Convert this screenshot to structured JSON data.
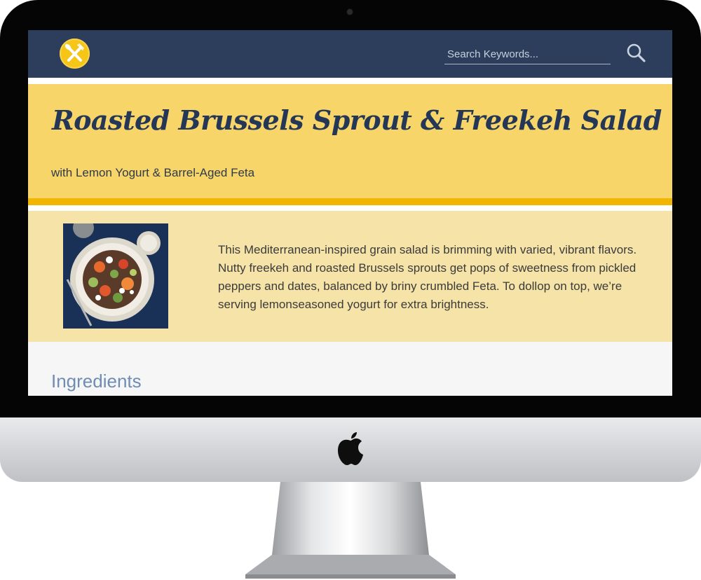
{
  "header": {
    "search": {
      "placeholder": "Search Keywords..."
    },
    "icons": {
      "logo": "fork-knife-logo-icon",
      "search": "search-icon"
    }
  },
  "recipe": {
    "title": "Roasted Brussels Sprout & Freekeh Salad",
    "subtitle": "with Lemon Yogurt & Barrel-Aged Feta",
    "description": "This Mediterranean-inspired grain salad is brimming with varied, vibrant flavors. Nutty freekeh and roasted Brussels sprouts get pops of sweetness from pickled peppers and dates, balanced by briny crumbled Feta. To dollop on top, we’re serving lemonseasoned yogurt for extra brightness.",
    "section_heading": "Ingredients"
  },
  "colors": {
    "navbar": "#2c3e5c",
    "hero": "#f8d568",
    "accent_rule": "#f2b600",
    "intro": "#f6e3a8",
    "title": "#243757",
    "section_heading": "#6f8cb4"
  }
}
